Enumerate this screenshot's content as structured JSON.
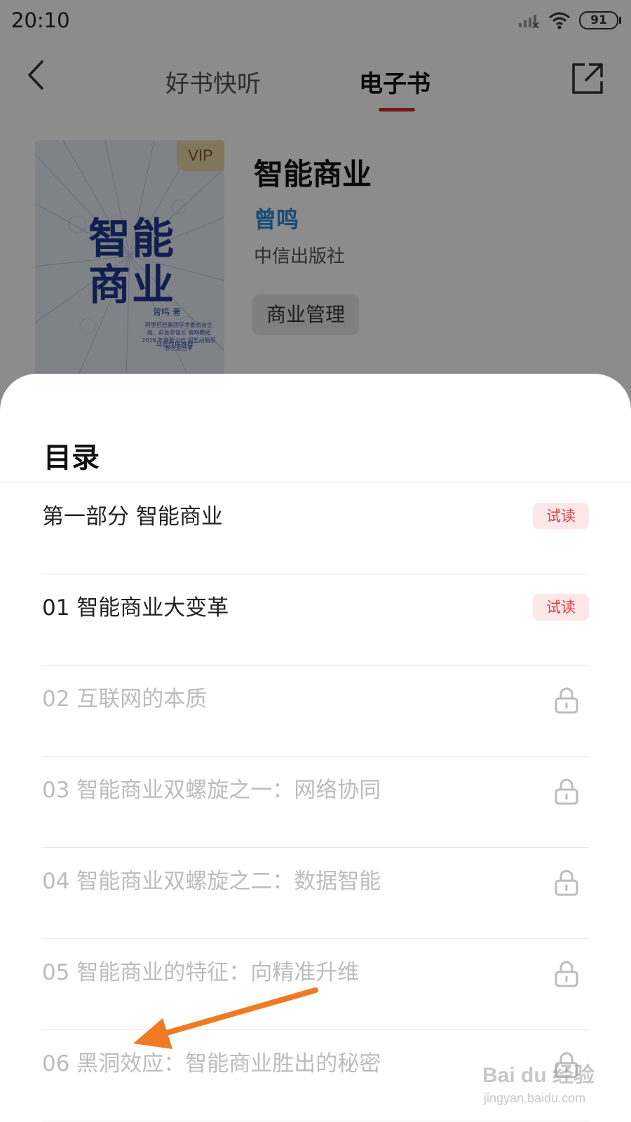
{
  "status_bar": {
    "time": "20:10",
    "battery": "91",
    "icons": [
      "signal-icon",
      "wifi-icon",
      "battery-icon"
    ]
  },
  "nav": {
    "back_icon": "back-arrow-icon",
    "tabs": [
      {
        "label": "好书快听",
        "active": false
      },
      {
        "label": "电子书",
        "active": true
      }
    ],
    "share_icon": "share-icon",
    "accent_color": "#d8302f"
  },
  "book": {
    "cover": {
      "vip_label": "VIP",
      "title_line1": "智能",
      "title_line2": "商业",
      "author": "曾鸣 著",
      "blurb": "阿里巴巴集团学术委员会主席、前总参谋长 曾鸣教授 2018 年最新力作 阿里战略思想全面分享",
      "recommend": "马云作序推荐"
    },
    "title": "智能商业",
    "author": "曾鸣",
    "publisher": "中信出版社",
    "tag": "商业管理"
  },
  "toc": {
    "title": "目录",
    "items": [
      {
        "label": "第一部分 智能商业",
        "badge": "试读",
        "locked": false
      },
      {
        "label": "01 智能商业大变革",
        "badge": "试读",
        "locked": false
      },
      {
        "label": "02 互联网的本质",
        "badge": "",
        "locked": true
      },
      {
        "label": "03 智能商业双螺旋之一：网络协同",
        "badge": "",
        "locked": true
      },
      {
        "label": "04 智能商业双螺旋之二：数据智能",
        "badge": "",
        "locked": true
      },
      {
        "label": "05 智能商业的特征：向精准升维",
        "badge": "",
        "locked": true
      },
      {
        "label": "06 黑洞效应：智能商业胜出的秘密",
        "badge": "",
        "locked": true
      }
    ]
  },
  "annotation": {
    "color": "#f07a22"
  },
  "watermark": {
    "main": "Bai du 经验",
    "sub": "jingyan.baidu.com"
  }
}
